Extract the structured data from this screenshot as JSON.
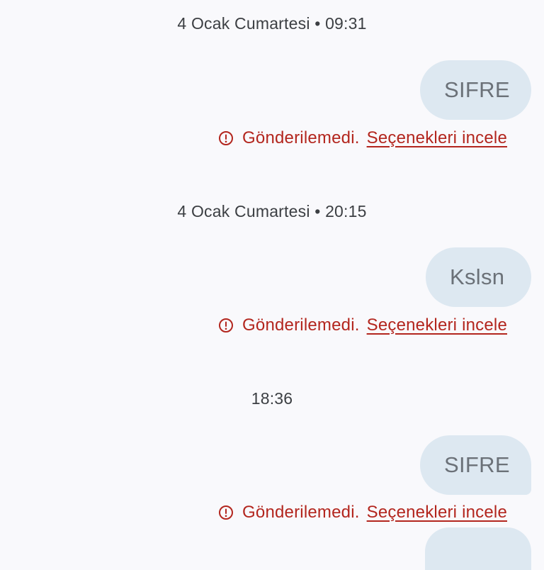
{
  "thread": {
    "items": [
      {
        "timestamp": "4 Ocak Cumartesi • 09:31",
        "message": "SIFRE",
        "status_text": "Gönderilemedi.",
        "status_link": "Seçenekleri incele"
      },
      {
        "timestamp": "4 Ocak Cumartesi • 20:15",
        "message": "Kslsn",
        "status_text": "Gönderilemedi.",
        "status_link": "Seçenekleri incele"
      },
      {
        "timestamp": "18:36",
        "message": "SIFRE",
        "status_text": "Gönderilemedi.",
        "status_link": "Seçenekleri incele"
      }
    ]
  },
  "colors": {
    "background": "#f9f9fc",
    "bubble": "#dde8f1",
    "bubble_text": "#6b7178",
    "error": "#b3261e",
    "timestamp": "#3c3f43"
  },
  "icons": {
    "status": "error-circle-icon"
  }
}
